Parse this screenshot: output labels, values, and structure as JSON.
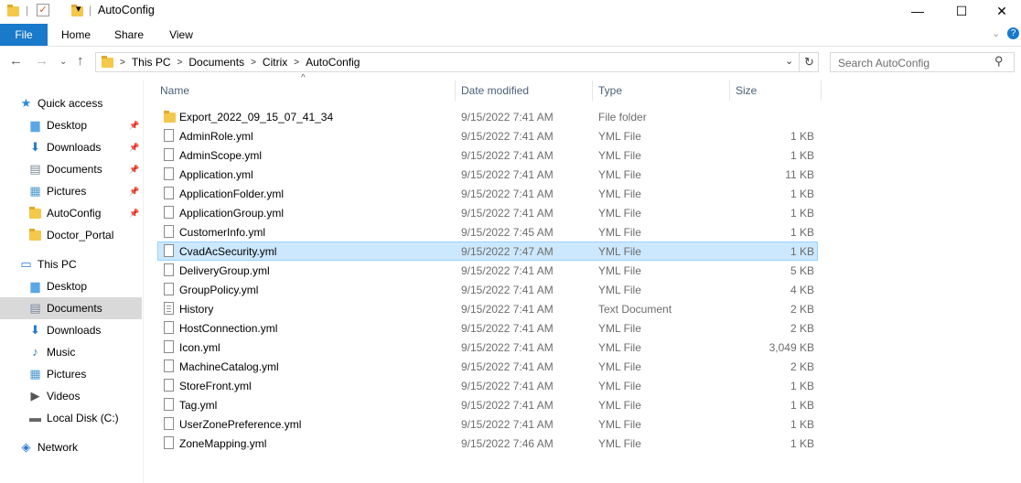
{
  "window": {
    "title": "AutoConfig",
    "minimize": "—",
    "maximize": "☐",
    "close": "✕"
  },
  "ribbon": {
    "tabs": [
      "File",
      "Home",
      "Share",
      "View"
    ]
  },
  "address": {
    "crumbs": [
      "This PC",
      "Documents",
      "Citrix",
      "AutoConfig"
    ]
  },
  "search": {
    "placeholder": "Search AutoConfig"
  },
  "columns": {
    "name": "Name",
    "date": "Date modified",
    "type": "Type",
    "size": "Size"
  },
  "nav": [
    {
      "label": "Quick access",
      "icon": "star",
      "indent": 0
    },
    {
      "label": "Desktop",
      "icon": "folder-blue",
      "indent": 1,
      "pinned": true
    },
    {
      "label": "Downloads",
      "icon": "download",
      "indent": 1,
      "pinned": true
    },
    {
      "label": "Documents",
      "icon": "documents",
      "indent": 1,
      "pinned": true
    },
    {
      "label": "Pictures",
      "icon": "pictures",
      "indent": 1,
      "pinned": true
    },
    {
      "label": "AutoConfig",
      "icon": "folder",
      "indent": 1,
      "pinned": true
    },
    {
      "label": "Doctor_Portal",
      "icon": "folder",
      "indent": 1
    },
    {
      "label": "This PC",
      "icon": "computer",
      "indent": 0
    },
    {
      "label": "Desktop",
      "icon": "folder-blue",
      "indent": 1
    },
    {
      "label": "Documents",
      "icon": "documents",
      "indent": 1,
      "selected": true
    },
    {
      "label": "Downloads",
      "icon": "download",
      "indent": 1
    },
    {
      "label": "Music",
      "icon": "music",
      "indent": 1
    },
    {
      "label": "Pictures",
      "icon": "pictures",
      "indent": 1
    },
    {
      "label": "Videos",
      "icon": "videos",
      "indent": 1
    },
    {
      "label": "Local Disk (C:)",
      "icon": "disk",
      "indent": 1
    },
    {
      "label": "Network",
      "icon": "network",
      "indent": 0
    }
  ],
  "files": [
    {
      "name": "Export_2022_09_15_07_41_34",
      "date": "9/15/2022 7:41 AM",
      "type": "File folder",
      "size": "",
      "icon": "folder"
    },
    {
      "name": "AdminRole.yml",
      "date": "9/15/2022 7:41 AM",
      "type": "YML File",
      "size": "1 KB",
      "icon": "file"
    },
    {
      "name": "AdminScope.yml",
      "date": "9/15/2022 7:41 AM",
      "type": "YML File",
      "size": "1 KB",
      "icon": "file"
    },
    {
      "name": "Application.yml",
      "date": "9/15/2022 7:41 AM",
      "type": "YML File",
      "size": "11 KB",
      "icon": "file"
    },
    {
      "name": "ApplicationFolder.yml",
      "date": "9/15/2022 7:41 AM",
      "type": "YML File",
      "size": "1 KB",
      "icon": "file"
    },
    {
      "name": "ApplicationGroup.yml",
      "date": "9/15/2022 7:41 AM",
      "type": "YML File",
      "size": "1 KB",
      "icon": "file"
    },
    {
      "name": "CustomerInfo.yml",
      "date": "9/15/2022 7:45 AM",
      "type": "YML File",
      "size": "1 KB",
      "icon": "file"
    },
    {
      "name": "CvadAcSecurity.yml",
      "date": "9/15/2022 7:47 AM",
      "type": "YML File",
      "size": "1 KB",
      "icon": "file",
      "selected": true
    },
    {
      "name": "DeliveryGroup.yml",
      "date": "9/15/2022 7:41 AM",
      "type": "YML File",
      "size": "5 KB",
      "icon": "file"
    },
    {
      "name": "GroupPolicy.yml",
      "date": "9/15/2022 7:41 AM",
      "type": "YML File",
      "size": "4 KB",
      "icon": "file"
    },
    {
      "name": "History",
      "date": "9/15/2022 7:41 AM",
      "type": "Text Document",
      "size": "2 KB",
      "icon": "text"
    },
    {
      "name": "HostConnection.yml",
      "date": "9/15/2022 7:41 AM",
      "type": "YML File",
      "size": "2 KB",
      "icon": "file"
    },
    {
      "name": "Icon.yml",
      "date": "9/15/2022 7:41 AM",
      "type": "YML File",
      "size": "3,049 KB",
      "icon": "file"
    },
    {
      "name": "MachineCatalog.yml",
      "date": "9/15/2022 7:41 AM",
      "type": "YML File",
      "size": "2 KB",
      "icon": "file"
    },
    {
      "name": "StoreFront.yml",
      "date": "9/15/2022 7:41 AM",
      "type": "YML File",
      "size": "1 KB",
      "icon": "file"
    },
    {
      "name": "Tag.yml",
      "date": "9/15/2022 7:41 AM",
      "type": "YML File",
      "size": "1 KB",
      "icon": "file"
    },
    {
      "name": "UserZonePreference.yml",
      "date": "9/15/2022 7:41 AM",
      "type": "YML File",
      "size": "1 KB",
      "icon": "file"
    },
    {
      "name": "ZoneMapping.yml",
      "date": "9/15/2022 7:46 AM",
      "type": "YML File",
      "size": "1 KB",
      "icon": "file"
    }
  ]
}
